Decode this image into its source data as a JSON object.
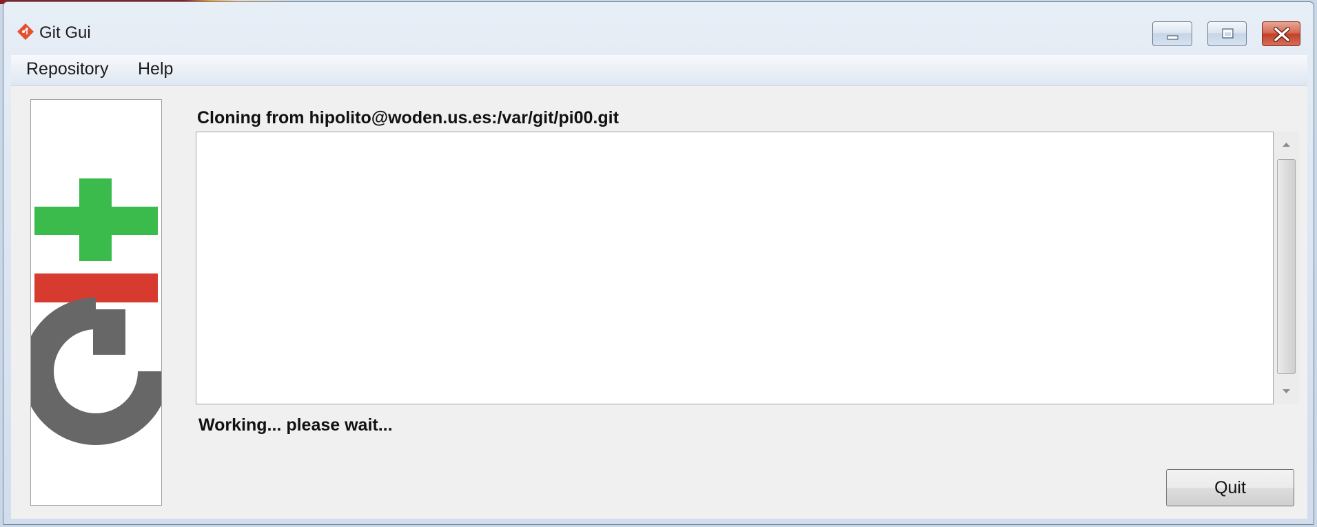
{
  "window": {
    "title": "Git Gui",
    "icon": "git-diamond-icon"
  },
  "menu": {
    "items": [
      {
        "label": "Repository"
      },
      {
        "label": "Help"
      }
    ]
  },
  "main": {
    "heading": "Cloning from hipolito@woden.us.es:/var/git/pi00.git",
    "output_text": "",
    "status": "Working... please wait...",
    "quit_label": "Quit"
  },
  "colors": {
    "logo_green": "#3bbb4c",
    "logo_red": "#d73a2f",
    "logo_gray": "#676767",
    "close_button": "#c24128"
  }
}
